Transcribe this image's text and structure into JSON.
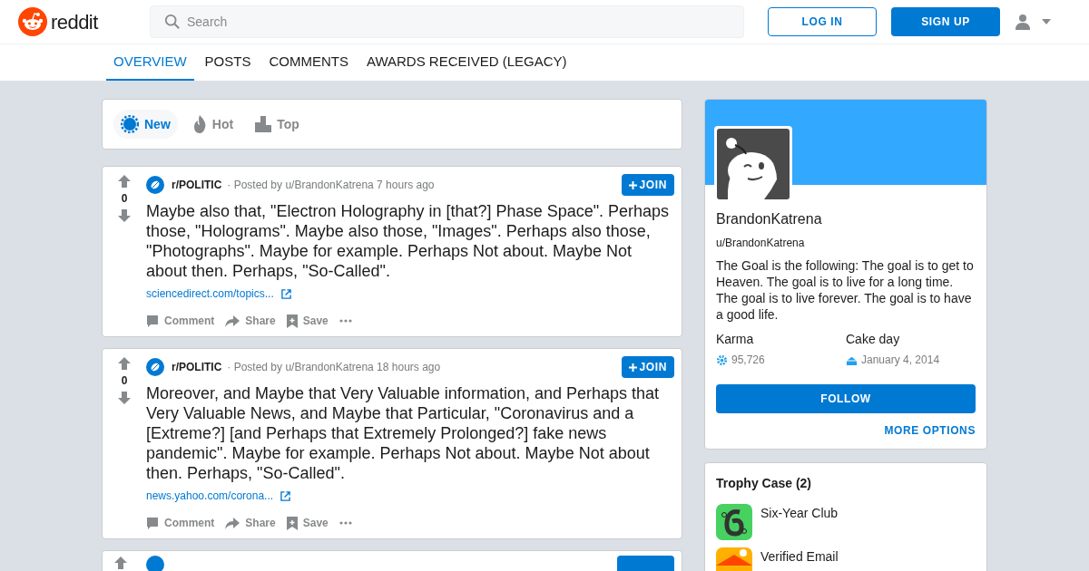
{
  "header": {
    "logo_text": "reddit",
    "search": {
      "placeholder": "Search"
    },
    "login": "LOG IN",
    "signup": "SIGN UP"
  },
  "tabs": [
    {
      "label": "OVERVIEW",
      "selected": true
    },
    {
      "label": "POSTS",
      "selected": false
    },
    {
      "label": "COMMENTS",
      "selected": false
    },
    {
      "label": "AWARDS RECEIVED (LEGACY)",
      "selected": false
    }
  ],
  "sort": [
    {
      "label": "New",
      "kind": "new",
      "selected": true
    },
    {
      "label": "Hot",
      "kind": "hot",
      "selected": false
    },
    {
      "label": "Top",
      "kind": "top",
      "selected": false
    }
  ],
  "posts": [
    {
      "score": "0",
      "subreddit": "r/POLITIC",
      "byline": "· Posted by u/BrandonKatrena 7 hours ago",
      "join": "JOIN",
      "title": "Maybe also that, \"Electron Holography in [that?] Phase Space\". Perhaps those, \"Holograms\". Maybe also those, \"Images\". Perhaps also those, \"Photographs\". Maybe for example. Perhaps Not about. Maybe Not about then. Perhaps, \"So-Called\".",
      "link": "sciencedirect.com/topics...",
      "actions": [
        "Comment",
        "Share",
        "Save"
      ]
    },
    {
      "score": "0",
      "subreddit": "r/POLITIC",
      "byline": "· Posted by u/BrandonKatrena 18 hours ago",
      "join": "JOIN",
      "title": "Moreover, and Maybe that Very Valuable information, and Perhaps that Very Valuable News, and Maybe that Particular, \"Coronavirus and a [Extreme?] [and Perhaps that Extremely Prolonged?] fake news pandemic\". Maybe for example. Perhaps Not about. Maybe Not about then. Perhaps, \"So-Called\".",
      "link": "news.yahoo.com/corona...",
      "actions": [
        "Comment",
        "Share",
        "Save"
      ]
    }
  ],
  "profile": {
    "display_name": "BrandonKatrena",
    "username": "u/BrandonKatrena",
    "bio": "The Goal is the following: The goal is to get to Heaven. The goal is to live for a long time. The goal is to live forever. The goal is to have a good life.",
    "karma_label": "Karma",
    "karma": "95,726",
    "cake_label": "Cake day",
    "cake_day": "January 4, 2014",
    "follow": "FOLLOW",
    "more": "MORE OPTIONS"
  },
  "trophies": {
    "title": "Trophy Case (2)",
    "items": [
      {
        "name": "Six-Year Club",
        "kind": "six-year"
      },
      {
        "name": "Verified Email",
        "kind": "email"
      }
    ]
  }
}
